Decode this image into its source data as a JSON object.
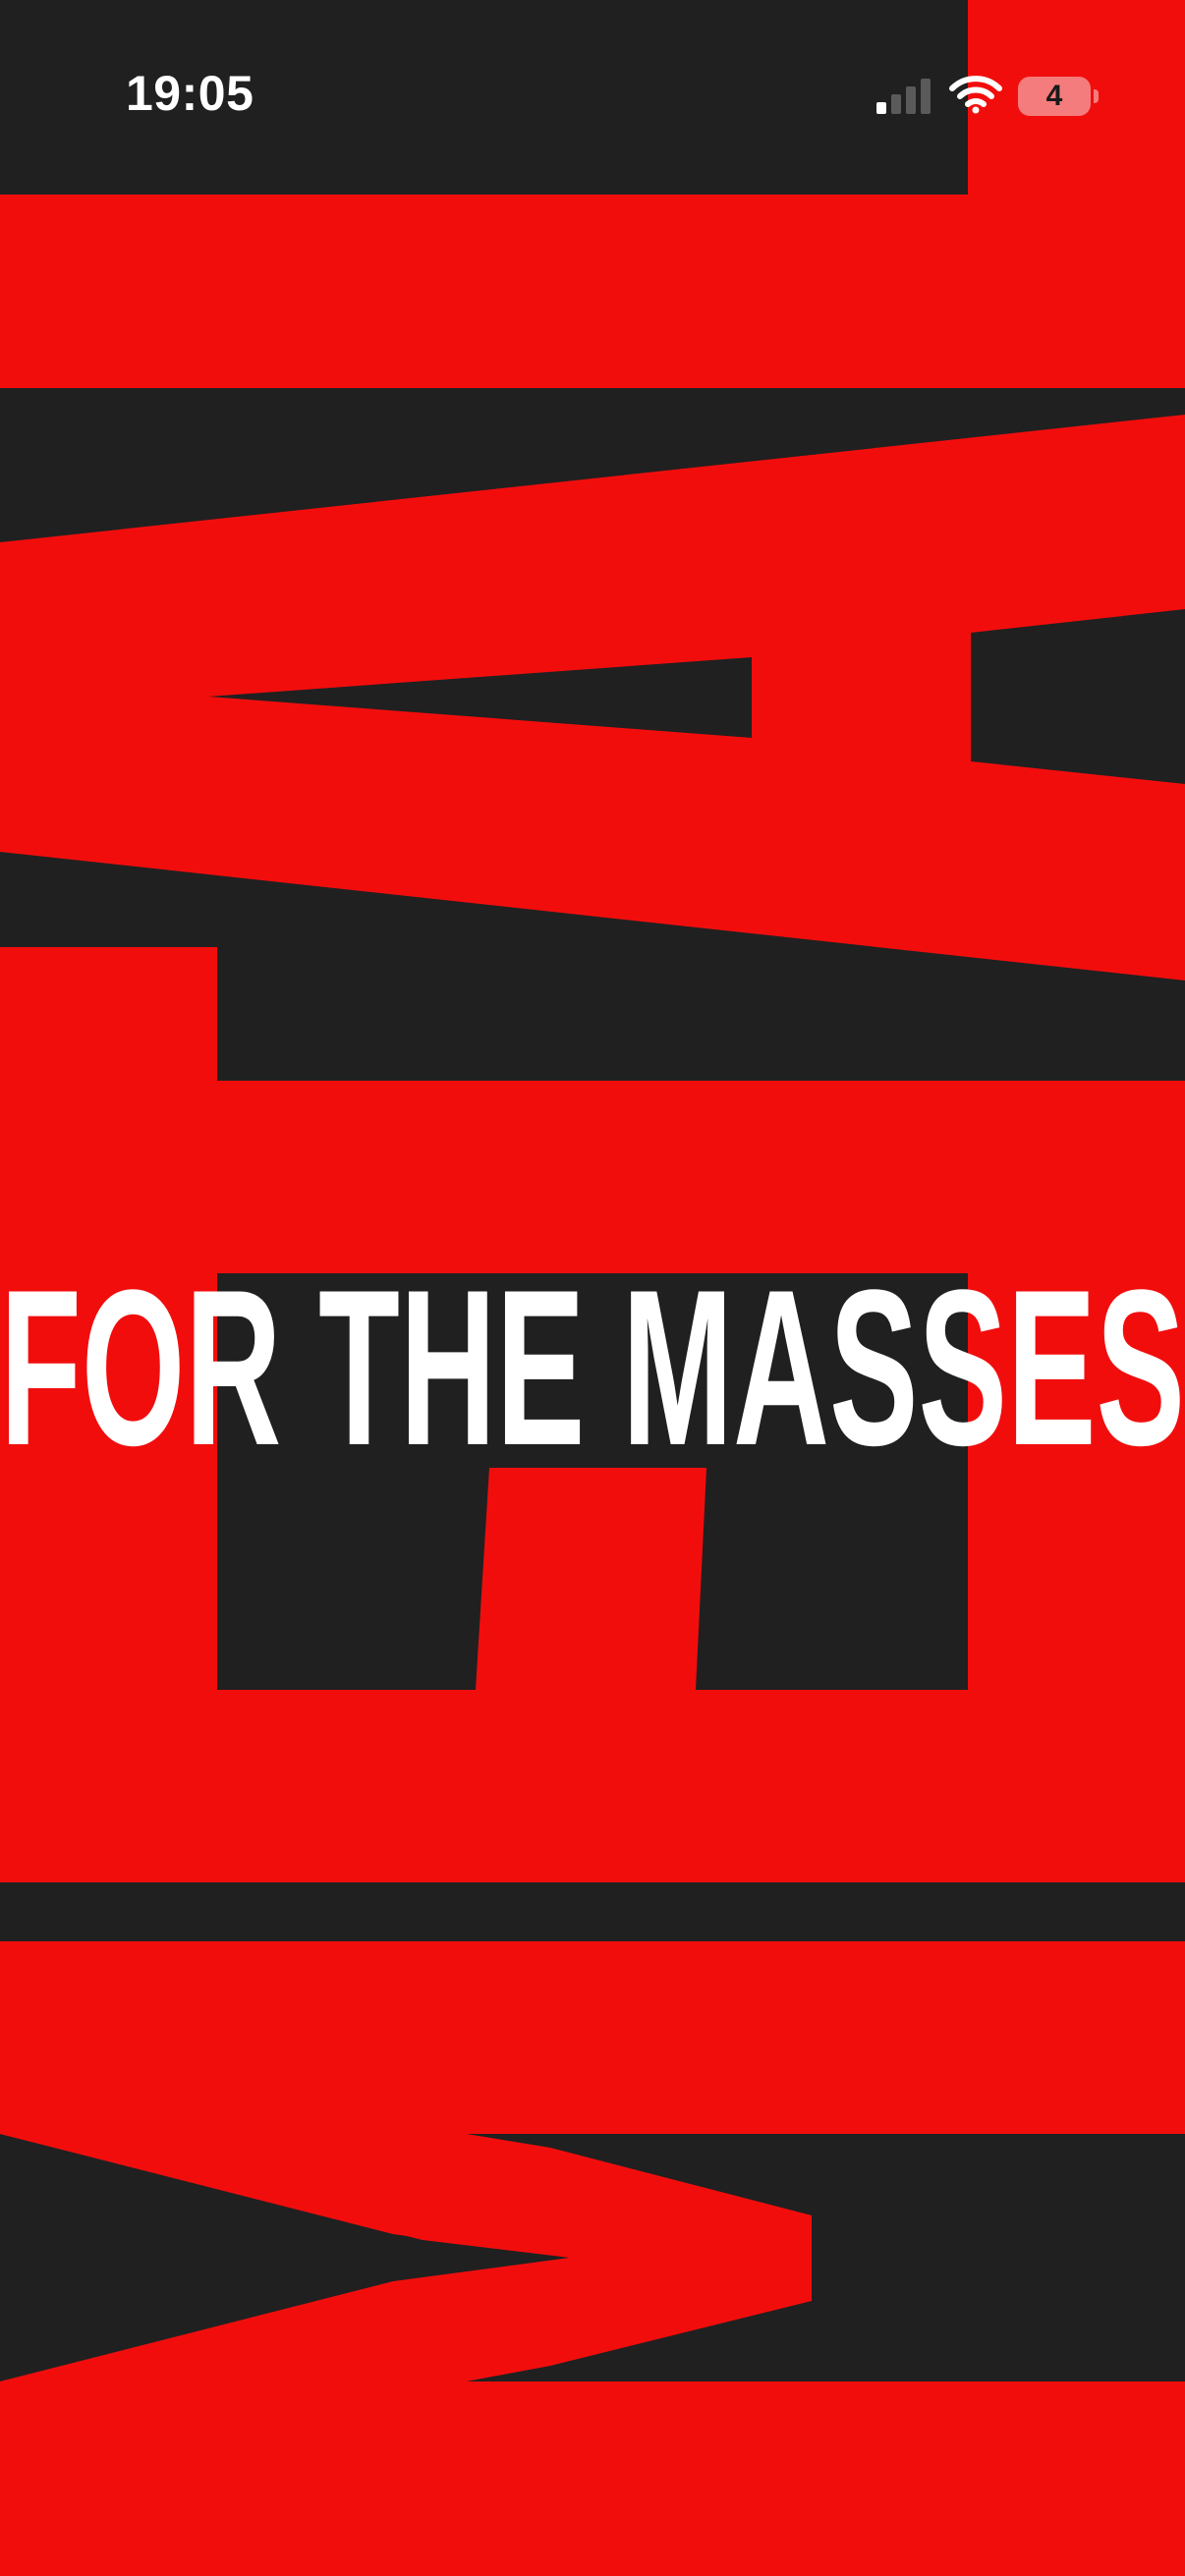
{
  "status_bar": {
    "time": "19:05",
    "battery_level": "4",
    "icons": [
      "signal-icon",
      "wifi-icon",
      "battery-icon"
    ]
  },
  "poster": {
    "headline": "FOR THE MASSES"
  },
  "colors": {
    "background": "#202020",
    "accent_red": "#f20d0d",
    "headline_text": "#ffffff",
    "battery_fill": "#f47c7c"
  }
}
